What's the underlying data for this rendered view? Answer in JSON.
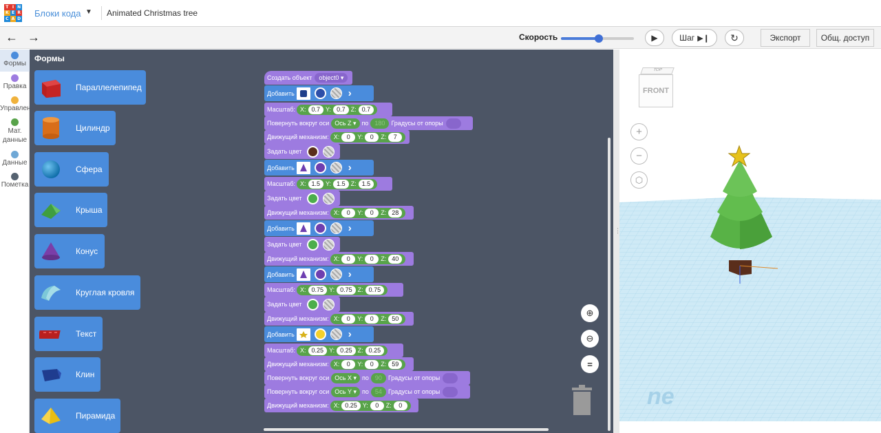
{
  "header": {
    "logo_letters": [
      "T",
      "I",
      "N",
      "K",
      "E",
      "R",
      "C",
      "A",
      "D"
    ],
    "mode_label": "Блоки кода",
    "project_title": "Animated Christmas tree"
  },
  "toolbar": {
    "undo_icon": "undo-arrow-icon",
    "redo_icon": "redo-arrow-icon",
    "speed_label": "Скорость",
    "speed_level_percent": 52,
    "step_label": "Шаг",
    "export_label": "Экспорт",
    "share_label": "Общ. доступ"
  },
  "categories": [
    {
      "label": "Формы",
      "color": "#4a8cdc"
    },
    {
      "label": "Правка",
      "color": "#9d7be0"
    },
    {
      "label": "Управлен",
      "color": "#f0b23c"
    },
    {
      "label": "Мат. данные",
      "color": "#58a34a"
    },
    {
      "label": "Данные",
      "color": "#6fa8d6"
    },
    {
      "label": "Пометка",
      "color": "#556270"
    }
  ],
  "flyout": {
    "title": "Формы",
    "shapes": [
      {
        "label": "Параллелепипед",
        "icon": "box-icon"
      },
      {
        "label": "Цилиндр",
        "icon": "cylinder-icon"
      },
      {
        "label": "Сфера",
        "icon": "sphere-icon"
      },
      {
        "label": "Крыша",
        "icon": "roof-icon"
      },
      {
        "label": "Конус",
        "icon": "cone-icon"
      },
      {
        "label": "Круглая кровля",
        "icon": "round-roof-icon"
      },
      {
        "label": "Текст",
        "icon": "text-shape-icon"
      },
      {
        "label": "Клин",
        "icon": "wedge-icon"
      },
      {
        "label": "Пирамида",
        "icon": "pyramid-icon"
      }
    ]
  },
  "blocks": {
    "create": {
      "label": "Создать объект",
      "object": "object0"
    },
    "add_label": "Добавить",
    "scale_label": "Масштаб:",
    "rotate_label": "Повернуть вокруг оси",
    "rotate_by": "по",
    "rotate_units": "Градусы",
    "rotate_from": "от опоры",
    "move_label": "Движущий механизм:",
    "color_label": "Задать цвет",
    "x": "X:",
    "y": "Y:",
    "z": "Z:",
    "scale1": [
      "0.7",
      "0.7",
      "0.7"
    ],
    "rotate1": {
      "axis": "Ось Z",
      "deg": "180"
    },
    "move1": [
      "0",
      "0",
      "7"
    ],
    "color1": "#5a2e1b",
    "add2_color": "#6e3fb0",
    "scale2": [
      "1.5",
      "1.5",
      "1.5"
    ],
    "color2": "#4cae4c",
    "move2": [
      "0",
      "0",
      "28"
    ],
    "add3_color": "#6e3fb0",
    "color3": "#4cae4c",
    "move3": [
      "0",
      "0",
      "40"
    ],
    "add4_color": "#6e3fb0",
    "scale4": [
      "0.75",
      "0.75",
      "0.75"
    ],
    "color4": "#4cae4c",
    "move4": [
      "0",
      "0",
      "50"
    ],
    "add5_color": "#f5d02c",
    "scale5": [
      "0.25",
      "0.25",
      "0.25"
    ],
    "move5": [
      "0",
      "0",
      "59"
    ],
    "rotate5": {
      "axis": "Ось X",
      "deg": "90"
    },
    "rotate6": {
      "axis": "Ось Y",
      "deg": "54"
    },
    "move6": [
      "0.25",
      "0",
      "0"
    ]
  },
  "viewcube": {
    "top": "TOP",
    "front": "FRONT"
  },
  "viewport_watermark": "ne"
}
